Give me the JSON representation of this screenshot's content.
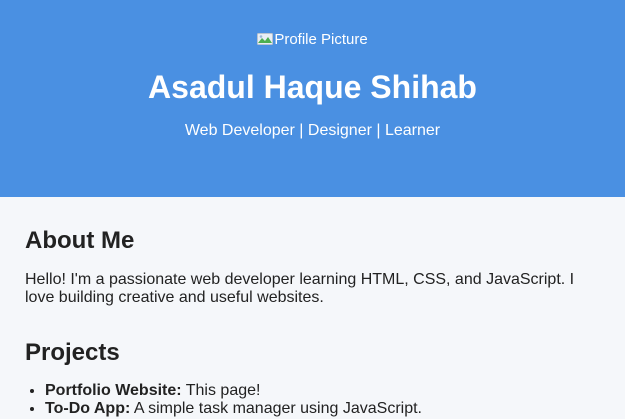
{
  "header": {
    "avatar_alt": "Profile Picture",
    "name": "Asadul Haque Shihab",
    "tagline": "Web Developer | Designer | Learner"
  },
  "about": {
    "title": "About Me",
    "text": "Hello! I'm a passionate web developer learning HTML, CSS, and JavaScript. I love building creative and useful websites."
  },
  "projects": {
    "title": "Projects",
    "items": [
      {
        "name": "Portfolio Website:",
        "desc": " This page!"
      },
      {
        "name": "To-Do App:",
        "desc": " A simple task manager using JavaScript."
      }
    ]
  },
  "colors": {
    "header_bg": "#4a90e2",
    "page_bg": "#f5f7fa"
  }
}
